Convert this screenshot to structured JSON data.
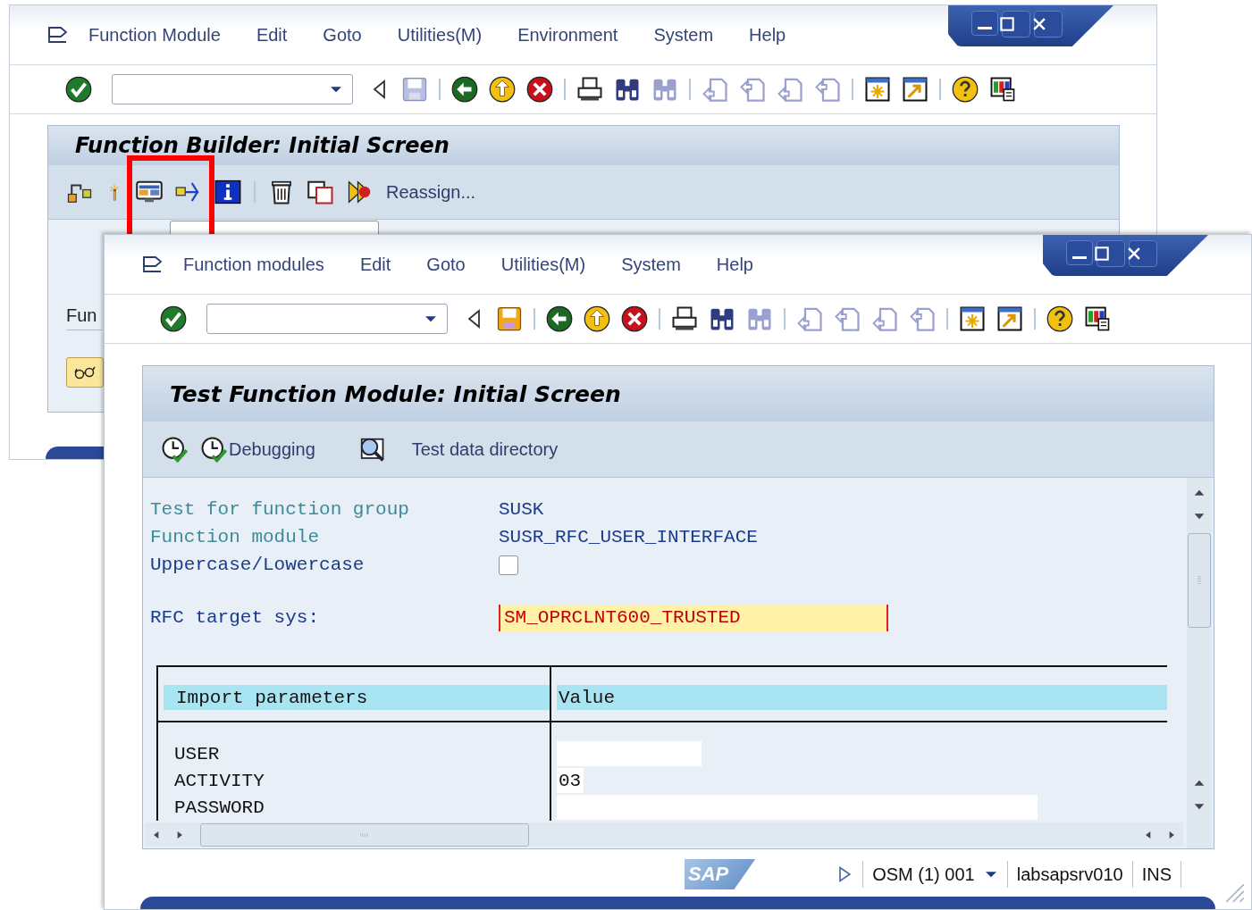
{
  "back_window": {
    "menu": [
      "Function Module",
      "Edit",
      "Goto",
      "Utilities(M)",
      "Environment",
      "System",
      "Help"
    ],
    "save_disabled": true,
    "title": "Function Builder: Initial Screen",
    "app_toolbar_text": "Reassign...",
    "field_label": "Fun"
  },
  "front_window": {
    "menu": [
      "Function modules",
      "Edit",
      "Goto",
      "Utilities(M)",
      "System",
      "Help"
    ],
    "save_disabled": false,
    "title": "Test Function Module: Initial Screen",
    "app_buttons": [
      "Debugging",
      "Test data directory"
    ],
    "form": [
      {
        "label": "Test for function group",
        "kind": "display",
        "value": "SUSK"
      },
      {
        "label": "Function module",
        "kind": "display",
        "value": "SUSR_RFC_USER_INTERFACE"
      },
      {
        "label": "Uppercase/Lowercase",
        "kind": "checkbox",
        "checked": false
      },
      {
        "label": "RFC target sys:",
        "kind": "field",
        "value": "SM_OPRCLNT600_TRUSTED"
      }
    ],
    "table": {
      "columns": [
        "Import parameters",
        "Value"
      ],
      "rows": [
        {
          "name": "USER",
          "kind": "medium"
        },
        {
          "name": "ACTIVITY",
          "kind": "small",
          "value": "03"
        },
        {
          "name": "PASSWORD",
          "kind": "long"
        }
      ]
    },
    "status_bar": {
      "logo": "SAP",
      "session": "OSM (1) 001",
      "server": "labsapsrv010",
      "mode": "INS"
    }
  }
}
